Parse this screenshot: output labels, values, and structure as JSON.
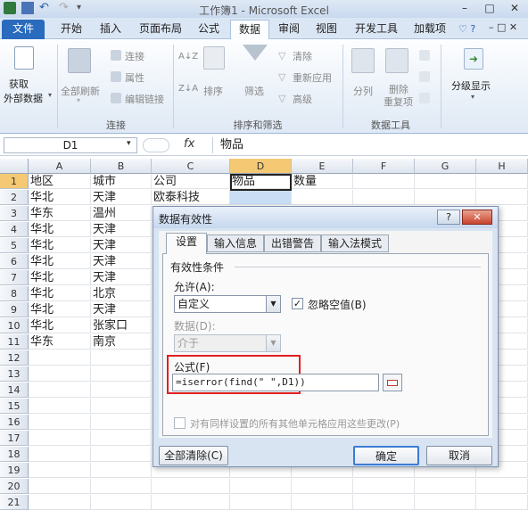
{
  "window": {
    "title": "工作簿1 - Microsoft Excel"
  },
  "tabs": [
    "文件",
    "开始",
    "插入",
    "页面布局",
    "公式",
    "数据",
    "审阅",
    "视图",
    "开发工具",
    "加载项"
  ],
  "ribbon": {
    "get_external_data": [
      "获取",
      "外部数据"
    ],
    "refresh_all": "全部刷新",
    "connections": "连接",
    "properties": "属性",
    "edit_links": "编辑链接",
    "group_connections": "连接",
    "sort": "排序",
    "filter": "筛选",
    "clear": "清除",
    "reapply": "重新应用",
    "advanced": "高级",
    "group_sort_filter": "排序和筛选",
    "text_to_columns": "分列",
    "remove_duplicates": [
      "删除",
      "重复项"
    ],
    "group_data_tools": "数据工具",
    "outline": "分级显示"
  },
  "formula_bar": {
    "name_box": "D1",
    "fx": "fx",
    "content": "物品"
  },
  "grid": {
    "columns": [
      "A",
      "B",
      "C",
      "D",
      "E",
      "F",
      "G",
      "H"
    ],
    "rows": [
      [
        "1",
        "地区",
        "城市",
        "公司",
        "物品",
        "数量"
      ],
      [
        "2",
        "华北",
        "天津",
        "欧泰科技",
        "",
        ""
      ],
      [
        "3",
        "华东",
        "温州",
        "",
        "",
        ""
      ],
      [
        "4",
        "华北",
        "天津",
        "",
        "",
        ""
      ],
      [
        "5",
        "华北",
        "天津",
        "",
        "",
        ""
      ],
      [
        "6",
        "华北",
        "天津",
        "",
        "",
        ""
      ],
      [
        "7",
        "华北",
        "天津",
        "",
        "",
        ""
      ],
      [
        "8",
        "华北",
        "北京",
        "",
        "",
        ""
      ],
      [
        "9",
        "华北",
        "天津",
        "",
        "",
        ""
      ],
      [
        "10",
        "华北",
        "张家口",
        "",
        "",
        ""
      ],
      [
        "11",
        "华东",
        "南京",
        "",
        "",
        ""
      ],
      [
        "12",
        "",
        "",
        "",
        "",
        ""
      ],
      [
        "13",
        "",
        "",
        "",
        "",
        ""
      ],
      [
        "14",
        "",
        "",
        "",
        "",
        ""
      ],
      [
        "15",
        "",
        "",
        "",
        "",
        ""
      ],
      [
        "16",
        "",
        "",
        "",
        "",
        ""
      ],
      [
        "17",
        "",
        "",
        "",
        "",
        ""
      ],
      [
        "18",
        "",
        "",
        "",
        "",
        ""
      ],
      [
        "19",
        "",
        "",
        "",
        "",
        ""
      ],
      [
        "20",
        "",
        "",
        "",
        "",
        ""
      ],
      [
        "21",
        "",
        "",
        "",
        "",
        ""
      ]
    ]
  },
  "dialog": {
    "title": "数据有效性",
    "help": "?",
    "close": "✕",
    "tabs": [
      "设置",
      "输入信息",
      "出错警告",
      "输入法模式"
    ],
    "section": "有效性条件",
    "allow_label": "允许(A):",
    "allow_value": "自定义",
    "ignore_blank": "忽略空值(B)",
    "data_label": "数据(D):",
    "data_value": "介于",
    "formula_label": "公式(F)",
    "formula_value": "=iserror(find(\" \",D1))",
    "apply_all": "对有同样设置的所有其他单元格应用这些更改(P)",
    "clear_all": "全部清除(C)",
    "ok": "确定",
    "cancel": "取消"
  },
  "colors": {
    "accent": "#2a6bbd",
    "highlight": "#e02020",
    "selected_header": "#f5c974"
  }
}
